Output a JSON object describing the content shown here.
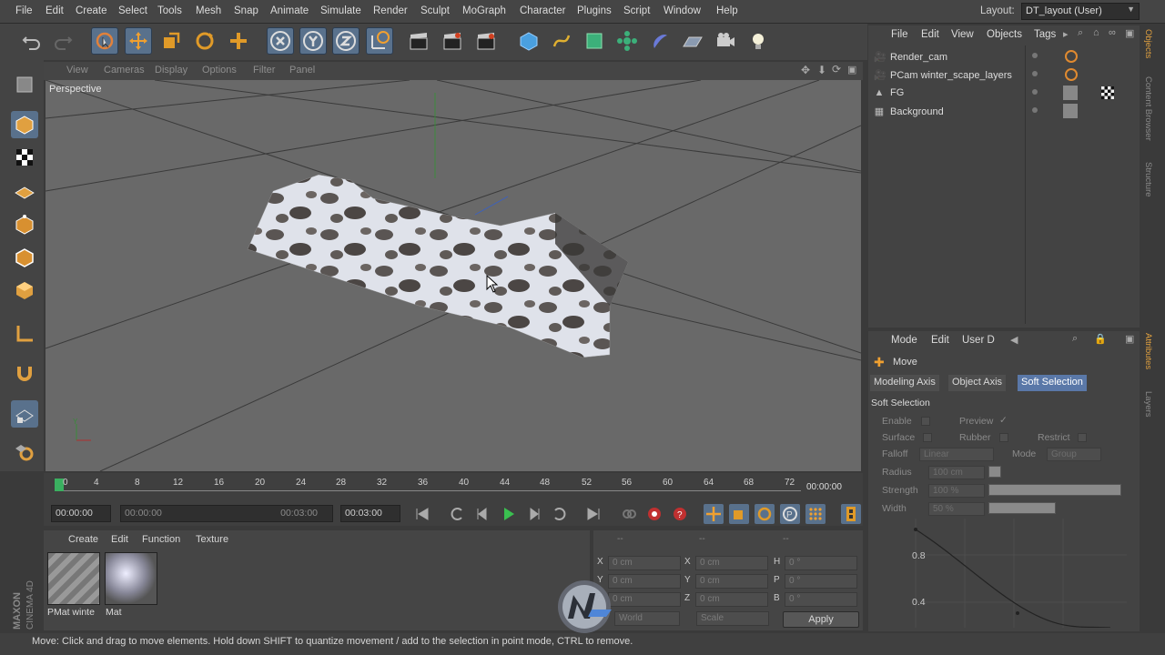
{
  "menu": [
    "File",
    "Edit",
    "Create",
    "Select",
    "Tools",
    "Mesh",
    "Snap",
    "Animate",
    "Simulate",
    "Render",
    "Sculpt",
    "MoGraph",
    "Character",
    "Plugins",
    "Script",
    "Window",
    "Help"
  ],
  "layout": {
    "label": "Layout:",
    "value": "DT_layout (User)"
  },
  "viewport": {
    "menu": [
      "View",
      "Cameras",
      "Display",
      "Options",
      "Filter",
      "Panel"
    ],
    "label": "Perspective"
  },
  "timeline": {
    "ticks": [
      "0",
      "4",
      "8",
      "12",
      "16",
      "20",
      "24",
      "28",
      "32",
      "36",
      "40",
      "44",
      "48",
      "52",
      "56",
      "60",
      "64",
      "68",
      "72"
    ],
    "current_time": "00:00:00"
  },
  "playback": {
    "start": "00:00:00",
    "range_start": "00:00:00",
    "range_end": "00:03:00",
    "end": "00:03:00"
  },
  "material_manager": {
    "menu": [
      "Create",
      "Edit",
      "Function",
      "Texture"
    ],
    "materials": [
      {
        "name": "PMat winte"
      },
      {
        "name": "Mat"
      }
    ]
  },
  "coordinates": {
    "header": [
      "--",
      "--",
      "--"
    ],
    "rows": [
      {
        "a": "X",
        "av": "0 cm",
        "b": "X",
        "bv": "0 cm",
        "c": "H",
        "cv": "0 °"
      },
      {
        "a": "Y",
        "av": "0 cm",
        "b": "Y",
        "bv": "0 cm",
        "c": "P",
        "cv": "0 °"
      },
      {
        "a": "Z",
        "av": "0 cm",
        "b": "Z",
        "bv": "0 cm",
        "c": "B",
        "cv": "0 °"
      }
    ],
    "world": "World",
    "scale": "Scale",
    "apply": "Apply"
  },
  "status": "Move: Click and drag to move elements. Hold down SHIFT to quantize movement / add to the selection in point mode, CTRL to remove.",
  "object_manager": {
    "menu": [
      "File",
      "Edit",
      "View",
      "Objects",
      "Tags"
    ],
    "objects": [
      {
        "name": "Render_cam",
        "icon": "camera-icon"
      },
      {
        "name": "PCam winter_scape_layers",
        "icon": "camera-icon"
      },
      {
        "name": "FG",
        "icon": "triangle-icon"
      },
      {
        "name": "Background",
        "icon": "background-icon"
      }
    ]
  },
  "attributes": {
    "menu": [
      "Mode",
      "Edit",
      "User D"
    ],
    "tool_name": "Move",
    "tabs": [
      "Modeling Axis",
      "Object Axis",
      "Soft Selection"
    ],
    "active_tab": "Soft Selection",
    "section": "Soft Selection",
    "fields": {
      "enable": "Enable",
      "preview": "Preview",
      "preview_check": "✓",
      "surface": "Surface",
      "rubber": "Rubber",
      "restrict": "Restrict",
      "falloff": "Falloff",
      "falloff_value": "Linear",
      "mode": "Mode",
      "mode_value": "Group",
      "radius": "Radius",
      "radius_value": "100 cm",
      "strength": "Strength",
      "strength_value": "100 %",
      "width": "Width",
      "width_value": "50 %"
    },
    "graph_labels": [
      "0.8",
      "0.4"
    ]
  },
  "side_tabs": [
    "Objects",
    "Content Browser",
    "Structure",
    "Attributes",
    "Layers"
  ],
  "brand": {
    "maxon": "MAXON",
    "cinema": "CINEMA 4D"
  },
  "colors": {
    "accent": "#5a78a8",
    "selected_tool": "#59718c",
    "viewport_bg": "#696969"
  }
}
